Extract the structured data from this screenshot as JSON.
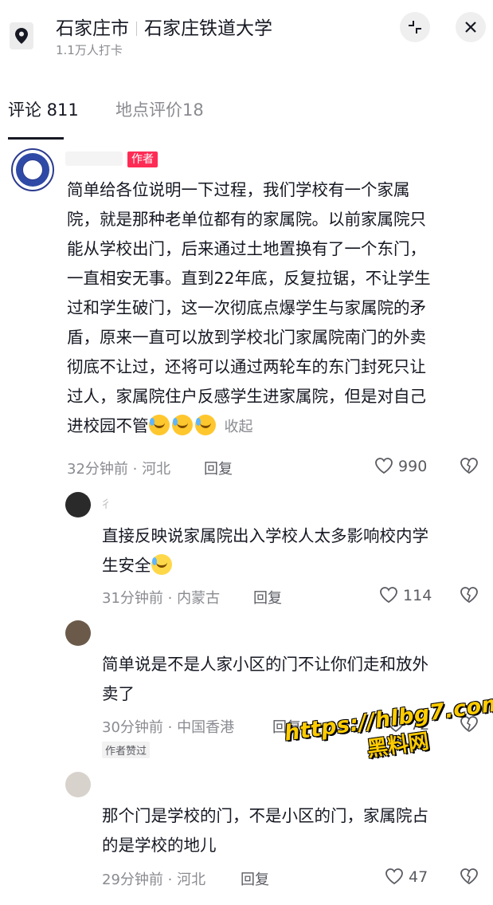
{
  "header": {
    "city": "石家庄市",
    "place": "石家庄铁道大学",
    "checkins": "1.1万人打卡"
  },
  "tabs": [
    {
      "label": "评论 811",
      "active": true
    },
    {
      "label": "地点评价18",
      "active": false
    }
  ],
  "main_comment": {
    "author_badge": "作者",
    "text": "简单给各位说明一下过程，我们学校有一个家属院，就是那种老单位都有的家属院。以前家属院只能从学校出门，后来通过土地置换有了一个东门，一直相安无事。直到22年底，反复拉锯，不让学生过和学生破门，这一次彻底点爆学生与家属院的矛盾，原来一直可以放到学校北门家属院南门的外卖彻底不让过，还将可以通过两轮车的东门封死只让过人，家属院住户反感学生进家属院，但是对自己进校园不管",
    "lines": [
      "简单给各位说明一下过程，我们学校有一个家属",
      "院，就是那种老单位都有的家属院。以前家属院只",
      "能从学校出门，后来通过土地置换有了一个东门，",
      "一直相安无事。直到22年底，反复拉锯，不让学生",
      "过和学生破门，这一次彻底点爆学生与家属院的矛",
      "盾，原来一直可以放到学校北门家属院南门的外卖",
      "彻底不让过，还将可以通过两轮车的东门封死只让",
      "过人，家属院住户反感学生进家属院，但是对自己",
      "进校园不管"
    ],
    "collapse_label": "收起",
    "time_location": "32分钟前 · 河北",
    "reply_label": "回复",
    "likes": "990"
  },
  "replies": [
    {
      "name": "彳",
      "lines": [
        "直接反映说家属院出入学校人太多影响校内学",
        "生安全"
      ],
      "time_location": "31分钟前 · 内蒙古",
      "reply_label": "回复",
      "likes": "114"
    },
    {
      "lines": [
        "简单说是不是人家小区的门不让你们走和放外",
        "卖了"
      ],
      "time_location": "30分钟前 · 中国香港",
      "reply_label": "回复",
      "likes": "72",
      "author_liked": "作者赞过"
    },
    {
      "lines": [
        "那个门是学校的门，不是小区的门，家属院占",
        "的是学校的地儿"
      ],
      "time_location": "29分钟前 · 河北",
      "reply_label": "回复",
      "likes": "47"
    }
  ],
  "watermark": {
    "url": "https://hlbg7.com",
    "text": "黑料网"
  }
}
